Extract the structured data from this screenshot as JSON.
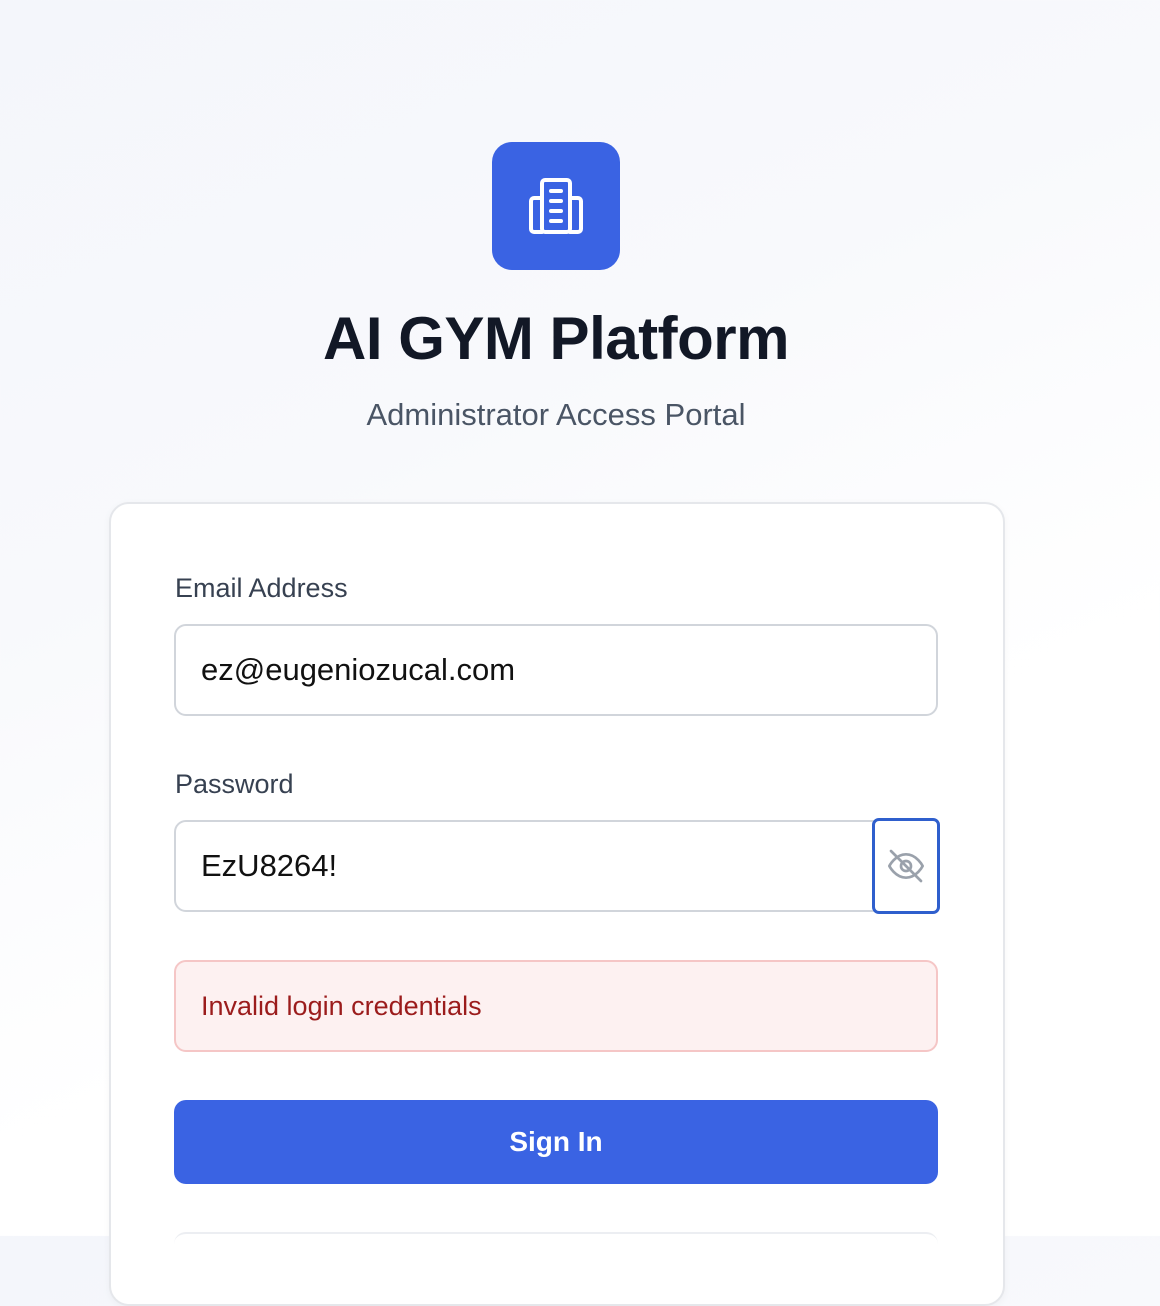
{
  "brand": {
    "title": "AI GYM Platform",
    "subtitle": "Administrator Access Portal",
    "logo_icon": "building-icon",
    "accent_color": "#3a63e3"
  },
  "form": {
    "email": {
      "label": "Email Address",
      "value": "ez@eugeniozucal.com"
    },
    "password": {
      "label": "Password",
      "value": "EzU8264!",
      "toggle_icon": "eye-off-icon"
    },
    "error_message": "Invalid login credentials",
    "submit_label": "Sign In"
  }
}
